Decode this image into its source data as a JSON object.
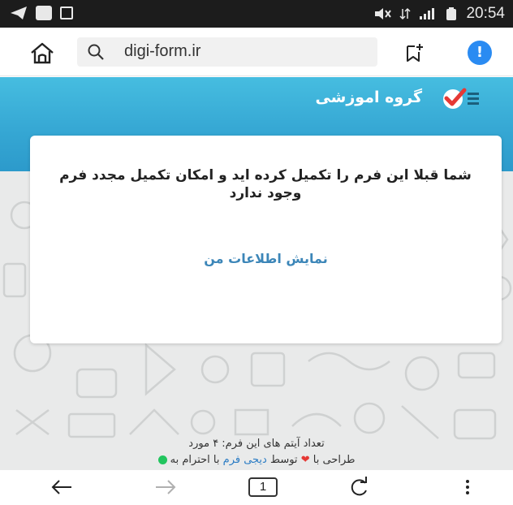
{
  "status_bar": {
    "time": "20:54"
  },
  "browser": {
    "url": "digi-form.ir",
    "alert_badge": "!",
    "tab_count": "1"
  },
  "brand": {
    "title": "گروه اموزشی"
  },
  "card": {
    "message": "شما قبلا این فرم را تکمیل کرده اید و امکان تکمیل مجدد فرم وجود ندارد",
    "link_label": "نمایش اطلاعات من"
  },
  "footer": {
    "item_count_label": "تعداد آیتم های این فرم: ۴ مورد",
    "designed_with": "طراحی با",
    "by": "توسط",
    "brand_name": "دیجی فرم",
    "with_respect_to": "با احترام به"
  },
  "colors": {
    "banner": "#36a8d4",
    "link": "#3c86b8",
    "alert": "#2a8bf2"
  },
  "icons": {
    "home": "home-icon",
    "search": "search-icon",
    "bookmark": "bookmark-add-icon",
    "back": "arrow-left-icon",
    "forward": "arrow-right-icon",
    "reload": "reload-icon",
    "menu": "more-vert-icon"
  }
}
